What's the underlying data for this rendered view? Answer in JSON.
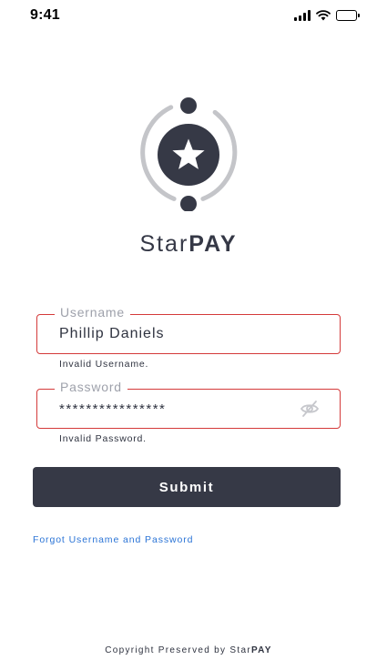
{
  "status_bar": {
    "time": "9:41",
    "icons": [
      "cellular-signal-icon",
      "wifi-icon",
      "battery-icon"
    ]
  },
  "logo": {
    "icon": "star-orbit-logo-icon",
    "brand_regular": "Star",
    "brand_bold": "PAY"
  },
  "form": {
    "username": {
      "label": "Username",
      "value": "Phillip Daniels",
      "error": "Invalid Username."
    },
    "password": {
      "label": "Password",
      "value": "****************",
      "error": "Invalid Password.",
      "toggle_icon": "eye-off-icon"
    },
    "submit_label": "Submit",
    "forgot_link": "Forgot Username and Password"
  },
  "footer": {
    "text_regular": "Copyright Preserved by Star",
    "text_bold": "PAY"
  },
  "colors": {
    "primary": "#363946",
    "error_border": "#d43a3a",
    "link": "#2b74d6",
    "label_gray": "#9ea1ab",
    "ring_gray": "#c4c5c9"
  }
}
